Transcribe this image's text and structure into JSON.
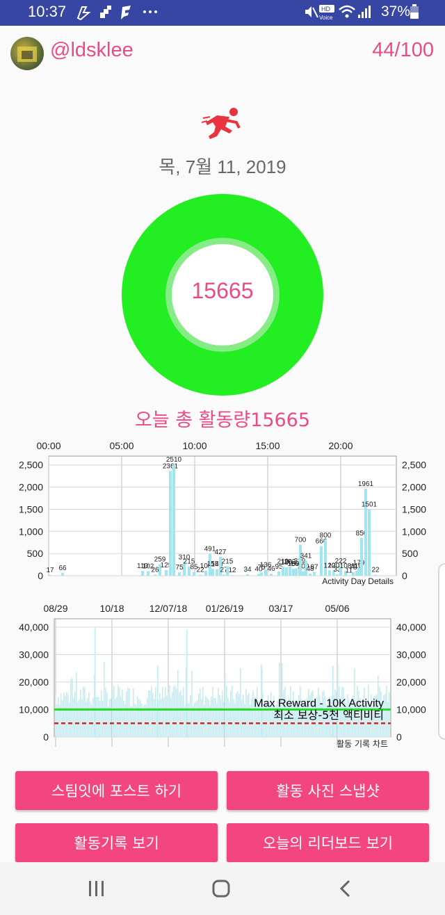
{
  "status_bar": {
    "time": "10:37",
    "battery": "37%"
  },
  "profile": {
    "username": "@ldsklee",
    "counter": "44/100"
  },
  "date": "목, 7월 11, 2019",
  "ring": {
    "value": "15665",
    "color": "#22ee22"
  },
  "total_label": "오늘 총 활동량15665",
  "charts": [
    {
      "type": "bar",
      "x_ticks": [
        "00:00",
        "05:00",
        "10:00",
        "15:00",
        "20:00"
      ],
      "y_ticks": [
        "2,500",
        "2,000",
        "1,500",
        "1,000",
        "500",
        "0"
      ],
      "ylim": [
        0,
        2700
      ],
      "legend": "Activity Day Details",
      "bar_color": "#9fe6f0",
      "data_labels": [
        "17",
        "66",
        "110",
        "102",
        "26",
        "259",
        "125",
        "2361",
        "2510",
        "75",
        "310",
        "215",
        "85",
        "22",
        "108",
        "491",
        "155",
        "146",
        "427",
        "27",
        "215",
        "12",
        "34",
        "40",
        "75",
        "136",
        "46",
        "95",
        "210",
        "186",
        "202",
        "156",
        "166",
        "219",
        "100",
        "700",
        "341",
        "48",
        "87",
        "666",
        "800",
        "120",
        "120",
        "33",
        "222",
        "108",
        "11",
        "78",
        "110",
        "179",
        "850",
        "1961",
        "1501",
        "22"
      ]
    },
    {
      "type": "bar",
      "x_ticks": [
        "08/29",
        "10/18",
        "12/07/18",
        "01/26/19",
        "03/17",
        "05/06"
      ],
      "y_ticks": [
        "40,000",
        "30,000",
        "20,000",
        "10,000",
        "0"
      ],
      "ylim": [
        0,
        43000
      ],
      "legend": "활동 기록 차트",
      "bar_color": "#bfeef5",
      "max_reward_label": "Max Reward - 10K Activity",
      "min_reward_label": "최소 보상-5천 액티비티",
      "max_reward_value": 10000,
      "min_reward_value": 5000,
      "max_line_color": "#22dd22",
      "min_line_color": "#dd2222"
    }
  ],
  "buttons": {
    "post": "스팀잇에 포스트 하기",
    "snapshot": "활동 사진 스냅샷",
    "history": "활동기록 보기",
    "leaderboard": "오늘의 리더보드 보기"
  },
  "colors": {
    "accent": "#ec4a87",
    "button": "#f3457f",
    "status_bar": "#3745a3"
  }
}
